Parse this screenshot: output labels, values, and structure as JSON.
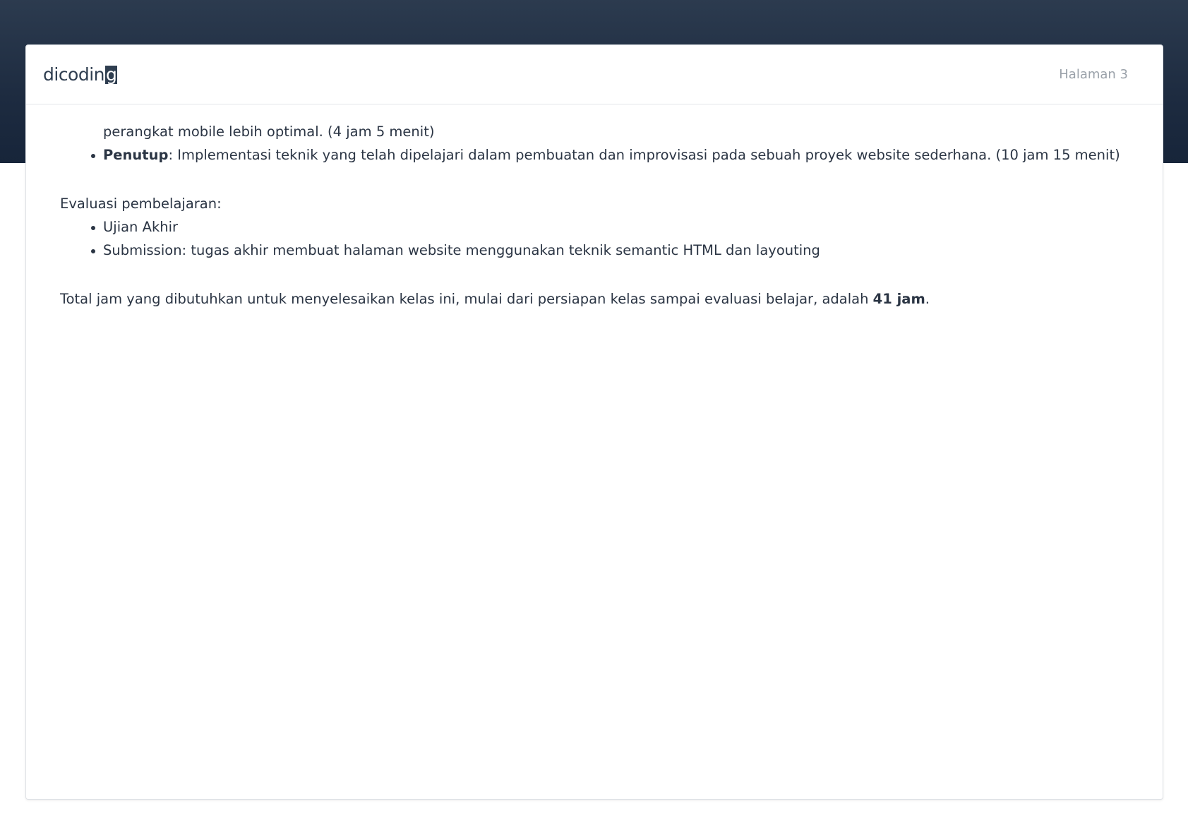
{
  "header": {
    "logo_text_main": "dicodin",
    "logo_text_last": "g",
    "page_label": "Halaman 3"
  },
  "content": {
    "continuation_line": "perangkat mobile lebih optimal. (4 jam 5 menit)",
    "closing_item": {
      "bold": "Penutup",
      "text": ": Implementasi teknik yang telah dipelajari dalam pembuatan dan improvisasi pada sebuah proyek website sederhana. (10 jam 15 menit)"
    },
    "evaluation_heading": "Evaluasi pembelajaran:",
    "evaluation_items": [
      "Ujian Akhir",
      "Submission: tugas akhir membuat halaman website menggunakan teknik semantic HTML dan layouting"
    ],
    "total_text_before": "Total jam yang dibutuhkan untuk menyelesaikan kelas ini, mulai dari persiapan kelas sampai evaluasi belajar, adalah ",
    "total_bold": "41 jam",
    "total_text_after": "."
  },
  "colors": {
    "header_band": "#1d2b40",
    "text": "#2b3544",
    "page_label": "#9aa1a9"
  }
}
